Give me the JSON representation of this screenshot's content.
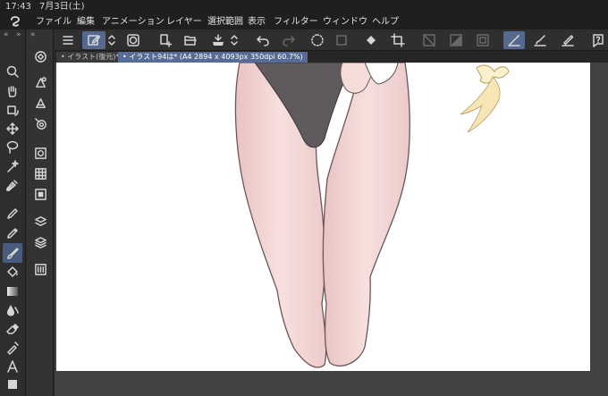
{
  "status_bar": {
    "time": "17:43",
    "date": "7月3日(土)"
  },
  "menu": [
    "ファイル",
    "編集",
    "アニメーション",
    "レイヤー",
    "選択範囲",
    "表示",
    "フィルター",
    "ウィンドウ",
    "ヘルプ"
  ],
  "tool_rail": {
    "collapse_left": "«",
    "collapse_right": "»",
    "tools": [
      "magnifier-icon",
      "hand-icon",
      "rotate-icon",
      "move-icon",
      "lasso-icon",
      "wand-icon",
      "eyedropper-icon",
      "pen-icon",
      "pencil-icon",
      "brush-icon",
      "fill-icon",
      "gradient-icon",
      "blend-icon",
      "eraser-icon",
      "decoration-icon",
      "text-icon",
      "figure-icon"
    ],
    "active_tool": "brush-icon"
  },
  "sub_rail": {
    "collapse": "«"
  },
  "command_bar": {
    "active_command": "canvas-edit-icon",
    "dimmed": [
      "redo-icon",
      "clear-icon",
      "fill-selection-icon",
      "crop-icon",
      "grayscale-icon",
      "tone-icon"
    ]
  },
  "tabs": [
    {
      "label": "イラスト(復元)*",
      "active": false
    },
    {
      "label": "イラスト94は* (A4 2894 x 4093px 350dpi 60.7%)",
      "active": true
    }
  ],
  "colors": {
    "ui_dark": "#1f1f1f",
    "panel": "#2e2e2e",
    "accent": "#566b95",
    "canvas_bg": "#ffffff",
    "skin": "#f3d9d7",
    "garment": "#5e5a5e",
    "hair": "#f7e6b5"
  }
}
